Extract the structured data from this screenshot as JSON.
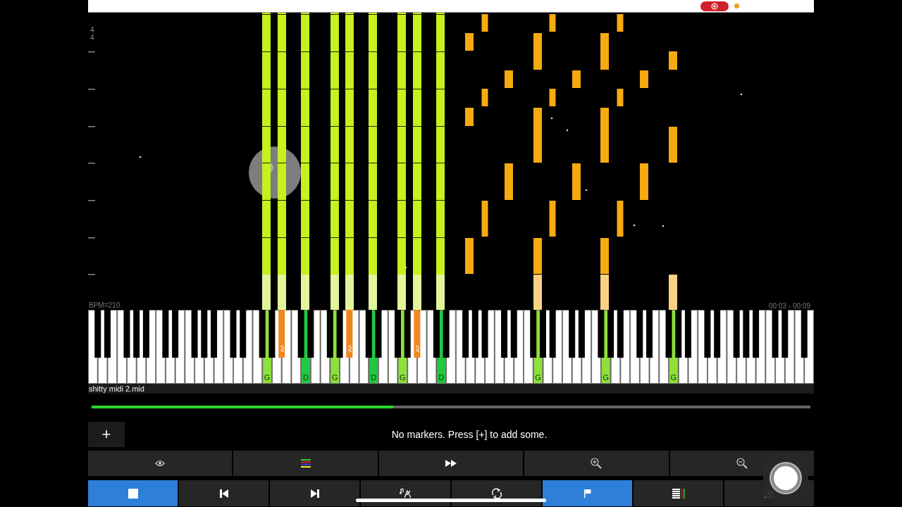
{
  "status_bar": {
    "recording": true
  },
  "roll": {
    "time_signature": {
      "numerator": "4",
      "denominator": "4"
    },
    "bpm": "BPM=210",
    "time": "00:03 - 00:09"
  },
  "keyboard": {
    "white_keys": [
      {
        "pressed": false
      },
      {
        "pressed": false
      },
      {
        "pressed": false
      },
      {
        "pressed": false
      },
      {
        "pressed": false
      },
      {
        "pressed": false
      },
      {
        "pressed": false
      },
      {
        "pressed": false
      },
      {
        "pressed": false
      },
      {
        "pressed": false
      },
      {
        "pressed": false
      },
      {
        "pressed": false
      },
      {
        "pressed": false
      },
      {
        "pressed": false
      },
      {
        "pressed": false
      },
      {
        "pressed": false
      },
      {
        "pressed": false
      },
      {
        "pressed": false
      },
      {
        "pressed": true,
        "label": "G",
        "color": "#8ee03a"
      },
      {
        "pressed": false
      },
      {
        "pressed": false
      },
      {
        "pressed": false
      },
      {
        "pressed": true,
        "label": "D",
        "color": "#22c840"
      },
      {
        "pressed": false
      },
      {
        "pressed": false
      },
      {
        "pressed": true,
        "label": "G",
        "color": "#8ee03a"
      },
      {
        "pressed": false
      },
      {
        "pressed": false
      },
      {
        "pressed": false
      },
      {
        "pressed": true,
        "label": "D",
        "color": "#22c840"
      },
      {
        "pressed": false
      },
      {
        "pressed": false
      },
      {
        "pressed": true,
        "label": "G",
        "color": "#8ee03a"
      },
      {
        "pressed": false
      },
      {
        "pressed": false
      },
      {
        "pressed": false
      },
      {
        "pressed": true,
        "label": "D",
        "color": "#22c840"
      },
      {
        "pressed": false
      },
      {
        "pressed": false
      },
      {
        "pressed": false
      },
      {
        "pressed": false
      },
      {
        "pressed": false
      },
      {
        "pressed": false
      },
      {
        "pressed": false
      },
      {
        "pressed": false
      },
      {
        "pressed": false
      },
      {
        "pressed": true,
        "label": "G",
        "color": "#8ee03a"
      },
      {
        "pressed": false
      },
      {
        "pressed": false
      },
      {
        "pressed": false
      },
      {
        "pressed": false
      },
      {
        "pressed": false
      },
      {
        "pressed": false
      },
      {
        "pressed": true,
        "label": "G",
        "color": "#8ee03a"
      },
      {
        "pressed": false
      },
      {
        "pressed": false
      },
      {
        "pressed": false
      },
      {
        "pressed": false
      },
      {
        "pressed": false
      },
      {
        "pressed": false
      },
      {
        "pressed": true,
        "label": "G",
        "color": "#8ee03a"
      },
      {
        "pressed": false
      },
      {
        "pressed": false
      },
      {
        "pressed": false
      },
      {
        "pressed": false
      },
      {
        "pressed": false
      },
      {
        "pressed": false
      },
      {
        "pressed": false
      },
      {
        "pressed": false
      },
      {
        "pressed": false
      },
      {
        "pressed": false
      },
      {
        "pressed": false
      },
      {
        "pressed": false
      },
      {
        "pressed": false
      },
      {
        "pressed": false
      }
    ],
    "black_keys": [
      {
        "pressed": false
      },
      {
        "pressed": false
      },
      {
        "pressed": false
      },
      {
        "pressed": false
      },
      {
        "pressed": false
      },
      {
        "pressed": false
      },
      {
        "pressed": false
      },
      {
        "pressed": false
      },
      {
        "pressed": false
      },
      {
        "pressed": false
      },
      {
        "pressed": false
      },
      {
        "pressed": false
      },
      {
        "pressed": false
      },
      {
        "pressed": false
      },
      {
        "pressed": true,
        "label": "A#",
        "color": "#f0861e"
      },
      {
        "pressed": false
      },
      {
        "pressed": false
      },
      {
        "pressed": false
      },
      {
        "pressed": false
      },
      {
        "pressed": true,
        "label": "A#",
        "color": "#f0861e"
      },
      {
        "pressed": false
      },
      {
        "pressed": false
      },
      {
        "pressed": false
      },
      {
        "pressed": false
      },
      {
        "pressed": true,
        "label": "A#",
        "color": "#f0861e"
      },
      {
        "pressed": false
      },
      {
        "pressed": false
      },
      {
        "pressed": false
      },
      {
        "pressed": false
      },
      {
        "pressed": false
      },
      {
        "pressed": false
      },
      {
        "pressed": false
      },
      {
        "pressed": false
      },
      {
        "pressed": false
      },
      {
        "pressed": false
      },
      {
        "pressed": false
      },
      {
        "pressed": false
      },
      {
        "pressed": false
      },
      {
        "pressed": false
      },
      {
        "pressed": false
      },
      {
        "pressed": false
      },
      {
        "pressed": false
      },
      {
        "pressed": false
      },
      {
        "pressed": false
      },
      {
        "pressed": false
      },
      {
        "pressed": false
      },
      {
        "pressed": false
      },
      {
        "pressed": false
      },
      {
        "pressed": false
      },
      {
        "pressed": false
      },
      {
        "pressed": false
      },
      {
        "pressed": false
      },
      {
        "pressed": false
      }
    ]
  },
  "file_name": "shitty midi 2.mid",
  "progress": {
    "level": 0.42
  },
  "markers": {
    "add_label": "+",
    "message": "No markers. Press [+] to add some."
  },
  "toolbar_top": [
    {
      "kind": "eye"
    },
    {
      "kind": "tracks"
    },
    {
      "kind": "fast-forward"
    },
    {
      "kind": "zoom-in"
    },
    {
      "kind": "zoom-out"
    }
  ],
  "toolbar_bottom": [
    {
      "kind": "stop",
      "selected": true
    },
    {
      "kind": "previous",
      "selected": false
    },
    {
      "kind": "next",
      "selected": false
    },
    {
      "kind": "notes",
      "selected": false
    },
    {
      "kind": "loop",
      "selected": false
    },
    {
      "kind": "flag",
      "selected": true
    },
    {
      "kind": "list",
      "selected": false
    },
    {
      "kind": "eject",
      "selected": false
    }
  ]
}
